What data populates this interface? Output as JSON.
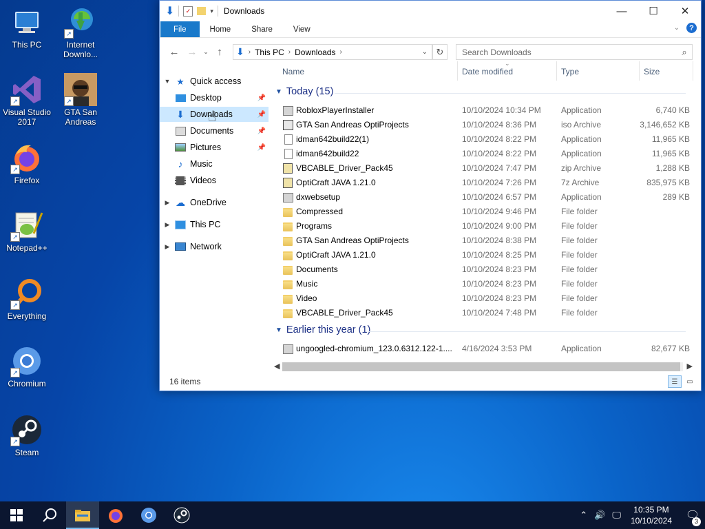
{
  "desktop": {
    "icons": [
      {
        "label": "This PC",
        "icon": "this-pc-icon"
      },
      {
        "label": "Internet Downlo...",
        "icon": "internet-download-manager-icon"
      },
      {
        "label": "Visual Studio 2017",
        "icon": "visual-studio-icon"
      },
      {
        "label": "GTA San Andreas",
        "icon": "gta-san-andreas-icon"
      },
      {
        "label": "Firefox",
        "icon": "firefox-icon"
      },
      {
        "label": "Notepad++",
        "icon": "notepad-plus-plus-icon"
      },
      {
        "label": "Everything",
        "icon": "everything-search-icon"
      },
      {
        "label": "Chromium",
        "icon": "chromium-icon"
      },
      {
        "label": "Steam",
        "icon": "steam-icon"
      }
    ]
  },
  "window": {
    "title": "Downloads",
    "ribbon_tabs": [
      "File",
      "Home",
      "Share",
      "View"
    ],
    "address": {
      "segments": [
        "This PC",
        "Downloads"
      ]
    },
    "search_placeholder": "Search Downloads",
    "nav": {
      "quick_access": "Quick access",
      "pinned": [
        "Desktop",
        "Downloads",
        "Documents",
        "Pictures"
      ],
      "unpinned": [
        "Music",
        "Videos"
      ],
      "roots": [
        "OneDrive",
        "This PC",
        "Network"
      ]
    },
    "columns": [
      "Name",
      "Date modified",
      "Type",
      "Size"
    ],
    "groups": [
      {
        "label": "Today (15)",
        "files": [
          {
            "name": "RobloxPlayerInstaller",
            "date": "10/10/2024 10:34 PM",
            "type": "Application",
            "size": "6,740 KB",
            "icon": "roblox-installer-icon"
          },
          {
            "name": "GTA San Andreas OptiProjects",
            "date": "10/10/2024 8:36 PM",
            "type": "iso Archive",
            "size": "3,146,652 KB",
            "icon": "iso-archive-icon"
          },
          {
            "name": "idman642build22(1)",
            "date": "10/10/2024 8:22 PM",
            "type": "Application",
            "size": "11,965 KB",
            "icon": "file-icon"
          },
          {
            "name": "idman642build22",
            "date": "10/10/2024 8:22 PM",
            "type": "Application",
            "size": "11,965 KB",
            "icon": "file-icon"
          },
          {
            "name": "VBCABLE_Driver_Pack45",
            "date": "10/10/2024 7:47 PM",
            "type": "zip Archive",
            "size": "1,288 KB",
            "icon": "zip-archive-icon"
          },
          {
            "name": "OptiCraft JAVA 1.21.0",
            "date": "10/10/2024 7:26 PM",
            "type": "7z Archive",
            "size": "835,975 KB",
            "icon": "7z-archive-icon"
          },
          {
            "name": "dxwebsetup",
            "date": "10/10/2024 6:57 PM",
            "type": "Application",
            "size": "289 KB",
            "icon": "setup-app-icon"
          },
          {
            "name": "Compressed",
            "date": "10/10/2024 9:46 PM",
            "type": "File folder",
            "size": "",
            "icon": "folder-icon"
          },
          {
            "name": "Programs",
            "date": "10/10/2024 9:00 PM",
            "type": "File folder",
            "size": "",
            "icon": "folder-icon"
          },
          {
            "name": "GTA San Andreas OptiProjects",
            "date": "10/10/2024 8:38 PM",
            "type": "File folder",
            "size": "",
            "icon": "folder-icon"
          },
          {
            "name": "OptiCraft JAVA 1.21.0",
            "date": "10/10/2024 8:25 PM",
            "type": "File folder",
            "size": "",
            "icon": "folder-icon"
          },
          {
            "name": "Documents",
            "date": "10/10/2024 8:23 PM",
            "type": "File folder",
            "size": "",
            "icon": "folder-icon"
          },
          {
            "name": "Music",
            "date": "10/10/2024 8:23 PM",
            "type": "File folder",
            "size": "",
            "icon": "folder-icon"
          },
          {
            "name": "Video",
            "date": "10/10/2024 8:23 PM",
            "type": "File folder",
            "size": "",
            "icon": "folder-icon"
          },
          {
            "name": "VBCABLE_Driver_Pack45",
            "date": "10/10/2024 7:48 PM",
            "type": "File folder",
            "size": "",
            "icon": "folder-icon"
          }
        ]
      },
      {
        "label": "Earlier this year (1)",
        "files": [
          {
            "name": "ungoogled-chromium_123.0.6312.122-1....",
            "date": "4/16/2024 3:53 PM",
            "type": "Application",
            "size": "82,677 KB",
            "icon": "setup-app-icon"
          }
        ]
      }
    ],
    "status": {
      "item_count": "16 items"
    }
  },
  "taskbar": {
    "apps": [
      "start-icon",
      "search-icon",
      "file-explorer-icon",
      "firefox-icon",
      "chromium-icon",
      "steam-icon"
    ],
    "time": "10:35 PM",
    "date": "10/10/2024",
    "notification_count": "3"
  },
  "colors": {
    "accent": "#1979ca",
    "selection": "#cce8ff",
    "group_header": "#1e3287",
    "taskbar": "#0b1630"
  }
}
